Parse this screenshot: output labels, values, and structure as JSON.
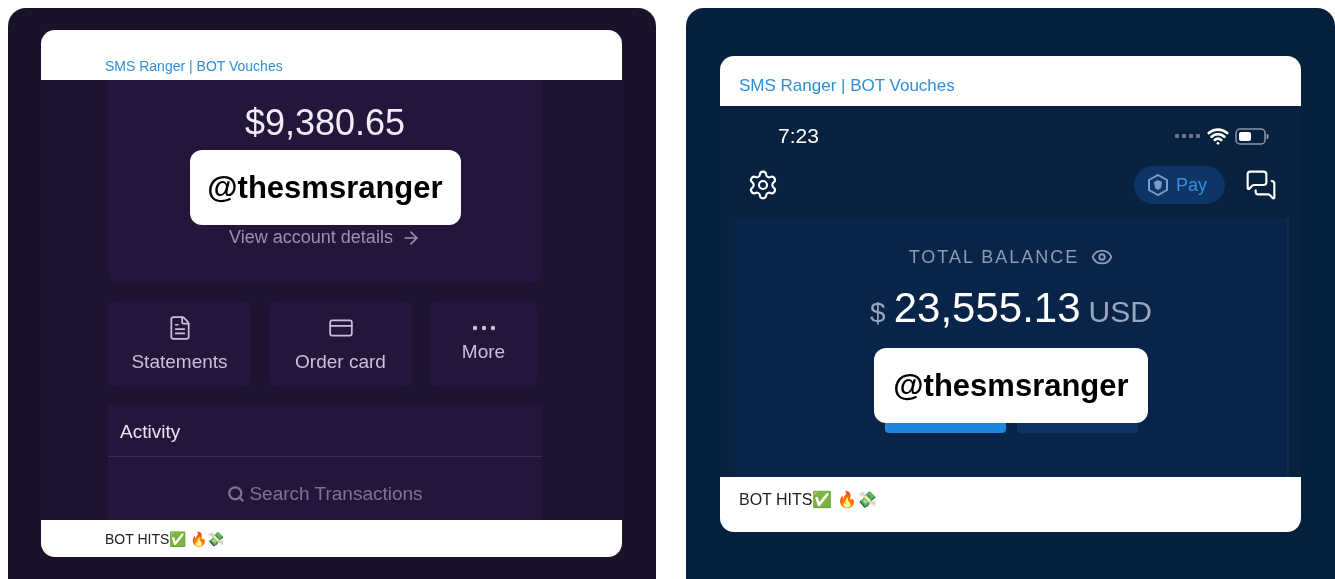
{
  "posts": [
    {
      "channel": "SMS Ranger | BOT Vouches",
      "screen": {
        "kind": "bank",
        "balance": "$9,380.65",
        "sticker": "@thesmsranger",
        "details_link": "View account details",
        "actions": [
          {
            "kind": "statements",
            "label": "Statements"
          },
          {
            "kind": "card",
            "label": "Order card"
          },
          {
            "kind": "more",
            "label": "More"
          }
        ],
        "activity_title": "Activity",
        "search": {
          "placeholder": "Search Transactions"
        }
      },
      "caption": "BOT HITS✅ 🔥💸"
    },
    {
      "channel": "SMS Ranger | BOT Vouches",
      "screen": {
        "kind": "crypto",
        "time": "7:23",
        "pay_label": "Pay",
        "balance_title": "TOTAL BALANCE",
        "currency": "$",
        "amount": "23,555.13",
        "unit": "USD",
        "sticker": "@thesmsranger"
      },
      "caption": "BOT HITS✅ 🔥💸"
    }
  ]
}
